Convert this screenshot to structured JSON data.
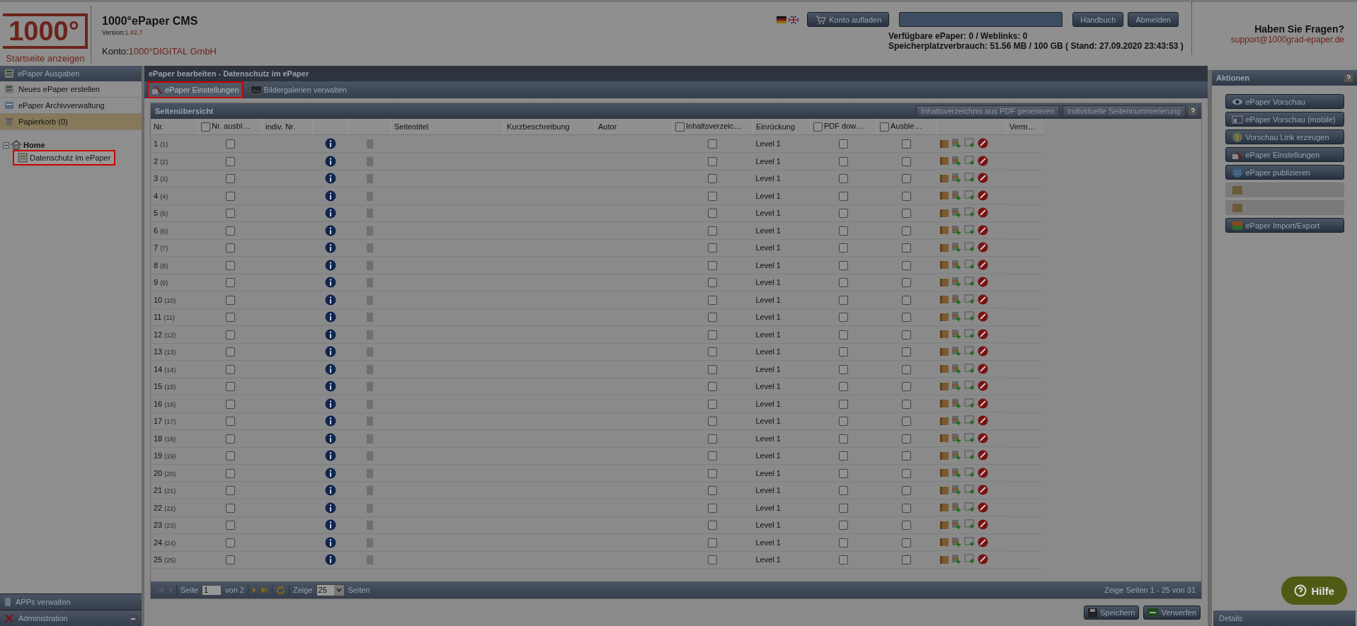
{
  "header": {
    "logo": "1000°",
    "logo_caption": "Startseite anzeigen",
    "app_title": "1000°ePaper CMS",
    "version_label": "Version:",
    "version": "1.82.7",
    "account_label": "Konto:",
    "account": "1000°DIGITAL GmbH",
    "topup_button": "Konto aufladen",
    "manual_button": "Handbuch",
    "logout_button": "Abmelden",
    "stats": [
      "Verfügbare ePaper: 0 / Weblinks: 0",
      "Speicherplatzverbrauch: 51.56 MB / 100 GB ( Stand: 27.09.2020 23:43:53 )"
    ],
    "help_title": "Haben Sie Fragen?",
    "help_email": "support@1000grad-epaper.de"
  },
  "sidebar": {
    "section": "ePaper Ausgaben",
    "items": [
      {
        "label": "Neues ePaper erstellen",
        "selected": false
      },
      {
        "label": "ePaper Archivverwaltung",
        "selected": false
      },
      {
        "label": "Papierkorb (0)",
        "selected": true
      }
    ],
    "tree": {
      "label": "Home",
      "expanded": true,
      "children": [
        {
          "label": "Datenschutz im ePaper",
          "selected": true
        }
      ]
    },
    "bottom_items": [
      "APPs verwalten",
      "Administration"
    ]
  },
  "main": {
    "title": "ePaper bearbeiten - Datenschutz im ePaper",
    "tabs": [
      {
        "label": "ePaper Einstellungen",
        "selected": true
      },
      {
        "label": "Bildergalerien verwalten",
        "selected": false
      }
    ],
    "panel_title": "Seitenübersicht",
    "panel_buttons": [
      "Inhaltsverzeichnis aus PDF generieren",
      "Individuelle Seitennummerierung"
    ],
    "columns": [
      {
        "label": "Nr.",
        "kind": "text"
      },
      {
        "label": "Nr. ausbl…",
        "kind": "checkbox",
        "checked": false
      },
      {
        "label": "indiv. Nr.",
        "kind": "text"
      },
      {
        "kind": "blank"
      },
      {
        "kind": "blank"
      },
      {
        "label": "Seitentitel",
        "kind": "text"
      },
      {
        "label": "Kurzbeschreibung",
        "kind": "text"
      },
      {
        "label": "Autor",
        "kind": "text"
      },
      {
        "label": "Inhaltsverzeic…",
        "kind": "checkbox",
        "checked": false
      },
      {
        "label": "Einrückung",
        "kind": "text"
      },
      {
        "label": "PDF dow…",
        "kind": "checkbox",
        "checked": false
      },
      {
        "label": "Ausble…",
        "kind": "checkbox",
        "checked": false
      },
      {
        "kind": "blank"
      },
      {
        "label": "Verm…",
        "kind": "text"
      }
    ],
    "rows": [
      {
        "nr": "1",
        "orig": "(1)",
        "nr_hidden": false,
        "in_toc": false,
        "indent": "Level 1",
        "pdf_download": false,
        "hidden": false
      },
      {
        "nr": "2",
        "orig": "(2)",
        "nr_hidden": false,
        "in_toc": false,
        "indent": "Level 1",
        "pdf_download": false,
        "hidden": false
      },
      {
        "nr": "3",
        "orig": "(3)",
        "nr_hidden": false,
        "in_toc": false,
        "indent": "Level 1",
        "pdf_download": false,
        "hidden": false
      },
      {
        "nr": "4",
        "orig": "(4)",
        "nr_hidden": false,
        "in_toc": false,
        "indent": "Level 1",
        "pdf_download": false,
        "hidden": false
      },
      {
        "nr": "5",
        "orig": "(5)",
        "nr_hidden": false,
        "in_toc": false,
        "indent": "Level 1",
        "pdf_download": false,
        "hidden": false
      },
      {
        "nr": "6",
        "orig": "(6)",
        "nr_hidden": false,
        "in_toc": false,
        "indent": "Level 1",
        "pdf_download": false,
        "hidden": false
      },
      {
        "nr": "7",
        "orig": "(7)",
        "nr_hidden": false,
        "in_toc": false,
        "indent": "Level 1",
        "pdf_download": false,
        "hidden": false
      },
      {
        "nr": "8",
        "orig": "(8)",
        "nr_hidden": false,
        "in_toc": false,
        "indent": "Level 1",
        "pdf_download": false,
        "hidden": false
      },
      {
        "nr": "9",
        "orig": "(9)",
        "nr_hidden": false,
        "in_toc": false,
        "indent": "Level 1",
        "pdf_download": false,
        "hidden": false
      },
      {
        "nr": "10",
        "orig": "(10)",
        "nr_hidden": false,
        "in_toc": false,
        "indent": "Level 1",
        "pdf_download": false,
        "hidden": false
      },
      {
        "nr": "11",
        "orig": "(11)",
        "nr_hidden": false,
        "in_toc": false,
        "indent": "Level 1",
        "pdf_download": false,
        "hidden": false
      },
      {
        "nr": "12",
        "orig": "(12)",
        "nr_hidden": false,
        "in_toc": false,
        "indent": "Level 1",
        "pdf_download": false,
        "hidden": false
      },
      {
        "nr": "13",
        "orig": "(13)",
        "nr_hidden": false,
        "in_toc": false,
        "indent": "Level 1",
        "pdf_download": false,
        "hidden": false
      },
      {
        "nr": "14",
        "orig": "(14)",
        "nr_hidden": false,
        "in_toc": false,
        "indent": "Level 1",
        "pdf_download": false,
        "hidden": false
      },
      {
        "nr": "15",
        "orig": "(15)",
        "nr_hidden": false,
        "in_toc": false,
        "indent": "Level 1",
        "pdf_download": false,
        "hidden": false
      },
      {
        "nr": "16",
        "orig": "(16)",
        "nr_hidden": false,
        "in_toc": false,
        "indent": "Level 1",
        "pdf_download": false,
        "hidden": false
      },
      {
        "nr": "17",
        "orig": "(17)",
        "nr_hidden": false,
        "in_toc": false,
        "indent": "Level 1",
        "pdf_download": false,
        "hidden": false
      },
      {
        "nr": "18",
        "orig": "(18)",
        "nr_hidden": false,
        "in_toc": false,
        "indent": "Level 1",
        "pdf_download": false,
        "hidden": false
      },
      {
        "nr": "19",
        "orig": "(19)",
        "nr_hidden": false,
        "in_toc": false,
        "indent": "Level 1",
        "pdf_download": false,
        "hidden": false
      },
      {
        "nr": "20",
        "orig": "(20)",
        "nr_hidden": false,
        "in_toc": false,
        "indent": "Level 1",
        "pdf_download": false,
        "hidden": false
      },
      {
        "nr": "21",
        "orig": "(21)",
        "nr_hidden": false,
        "in_toc": false,
        "indent": "Level 1",
        "pdf_download": false,
        "hidden": false
      },
      {
        "nr": "22",
        "orig": "(22)",
        "nr_hidden": false,
        "in_toc": false,
        "indent": "Level 1",
        "pdf_download": false,
        "hidden": false
      },
      {
        "nr": "23",
        "orig": "(23)",
        "nr_hidden": false,
        "in_toc": false,
        "indent": "Level 1",
        "pdf_download": false,
        "hidden": false
      },
      {
        "nr": "24",
        "orig": "(24)",
        "nr_hidden": false,
        "in_toc": false,
        "indent": "Level 1",
        "pdf_download": false,
        "hidden": false
      },
      {
        "nr": "25",
        "orig": "(25)",
        "nr_hidden": false,
        "in_toc": false,
        "indent": "Level 1",
        "pdf_download": false,
        "hidden": false
      }
    ],
    "pager": {
      "page_label": "Seite",
      "page": "1",
      "of": "von 2",
      "show_label": "Zeige",
      "per_page": "25",
      "per_page_suffix": "Seiten",
      "summary": "Zeige Seiten 1 - 25 von 31"
    },
    "footer_buttons": [
      "Speichern",
      "Verwerfen"
    ]
  },
  "actions": {
    "title": "Aktionen",
    "buttons": [
      {
        "label": "ePaper Vorschau",
        "disabled": false
      },
      {
        "label": "ePaper Vorschau (mobile)",
        "disabled": false
      },
      {
        "label": "Vorschau Link erzeugen",
        "disabled": false
      },
      {
        "label": "ePaper Einstellungen",
        "disabled": false
      },
      {
        "label": "ePaper publizieren",
        "disabled": false
      },
      {
        "disabled": true
      },
      {
        "disabled": true
      },
      {
        "label": "ePaper Import/Export",
        "disabled": false
      }
    ],
    "details": "Details",
    "help_button": "Hilfe"
  }
}
